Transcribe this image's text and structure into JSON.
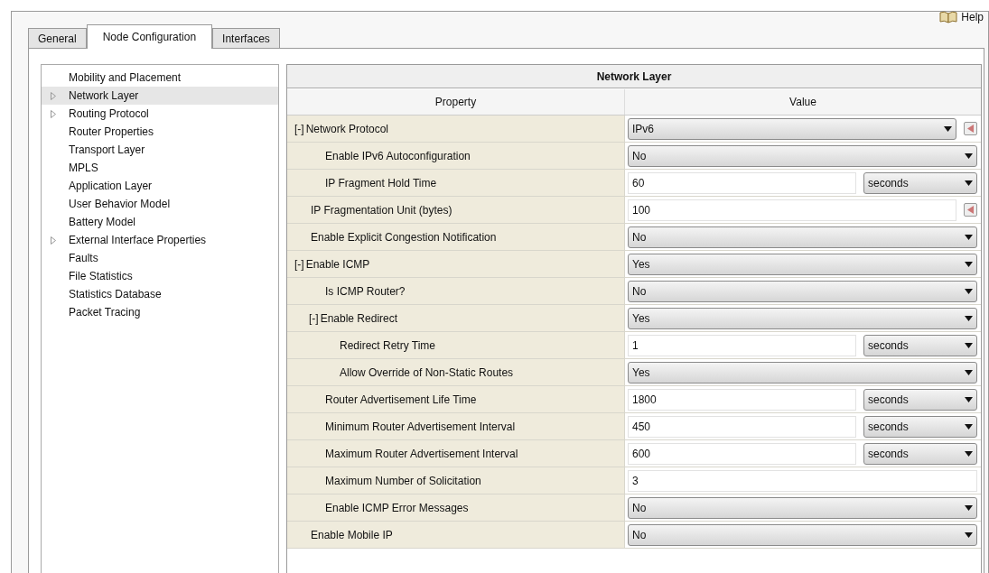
{
  "tabs": [
    {
      "label": "General",
      "selected": false
    },
    {
      "label": "Node Configuration",
      "selected": true
    },
    {
      "label": "Interfaces",
      "selected": false
    }
  ],
  "help": {
    "label": "Help"
  },
  "sidebar": {
    "items": [
      {
        "label": "Mobility and Placement",
        "expandable": false,
        "selected": false
      },
      {
        "label": "Network Layer",
        "expandable": true,
        "selected": true
      },
      {
        "label": "Routing Protocol",
        "expandable": true,
        "selected": false
      },
      {
        "label": "Router Properties",
        "expandable": false,
        "selected": false
      },
      {
        "label": "Transport Layer",
        "expandable": false,
        "selected": false
      },
      {
        "label": "MPLS",
        "expandable": false,
        "selected": false
      },
      {
        "label": "Application Layer",
        "expandable": false,
        "selected": false
      },
      {
        "label": "User Behavior Model",
        "expandable": false,
        "selected": false
      },
      {
        "label": "Battery Model",
        "expandable": false,
        "selected": false
      },
      {
        "label": "External Interface Properties",
        "expandable": true,
        "selected": false
      },
      {
        "label": "Faults",
        "expandable": false,
        "selected": false
      },
      {
        "label": "File Statistics",
        "expandable": false,
        "selected": false
      },
      {
        "label": "Statistics Database",
        "expandable": false,
        "selected": false
      },
      {
        "label": "Packet Tracing",
        "expandable": false,
        "selected": false
      }
    ]
  },
  "panel": {
    "title": "Network Layer",
    "columns": [
      "Property",
      "Value"
    ],
    "rows": [
      {
        "toggle": "[-]",
        "label": "Network Protocol",
        "kind": "select",
        "value": "IPv6",
        "reset_button": true,
        "children": [
          {
            "label": "Enable IPv6 Autoconfiguration",
            "kind": "select",
            "value": "No"
          },
          {
            "label": "IP Fragment Hold Time",
            "kind": "text_unit",
            "value": "60",
            "unit": "seconds"
          }
        ]
      },
      {
        "label": "IP Fragmentation Unit (bytes)",
        "kind": "text",
        "value": "100",
        "reset_button": true
      },
      {
        "label": "Enable Explicit Congestion Notification",
        "kind": "select",
        "value": "No"
      },
      {
        "toggle": "[-]",
        "label": "Enable ICMP",
        "kind": "select",
        "value": "Yes",
        "children": [
          {
            "label": "Is ICMP Router?",
            "kind": "select",
            "value": "No"
          },
          {
            "toggle": "[-]",
            "label": "Enable Redirect",
            "kind": "select",
            "value": "Yes",
            "children": [
              {
                "label": "Redirect Retry Time",
                "kind": "text_unit",
                "value": "1",
                "unit": "seconds"
              },
              {
                "label": "Allow Override of Non-Static Routes",
                "kind": "select",
                "value": "Yes"
              }
            ]
          },
          {
            "label": "Router Advertisement Life Time",
            "kind": "text_unit",
            "value": "1800",
            "unit": "seconds"
          },
          {
            "label": "Minimum Router Advertisement Interval",
            "kind": "text_unit",
            "value": "450",
            "unit": "seconds"
          },
          {
            "label": "Maximum Router Advertisement Interval",
            "kind": "text_unit",
            "value": "600",
            "unit": "seconds"
          },
          {
            "label": "Maximum Number of Solicitation",
            "kind": "text",
            "value": "3"
          },
          {
            "label": "Enable ICMP Error Messages",
            "kind": "select",
            "value": "No"
          }
        ]
      },
      {
        "label": "Enable Mobile IP",
        "kind": "select",
        "value": "No"
      }
    ]
  }
}
